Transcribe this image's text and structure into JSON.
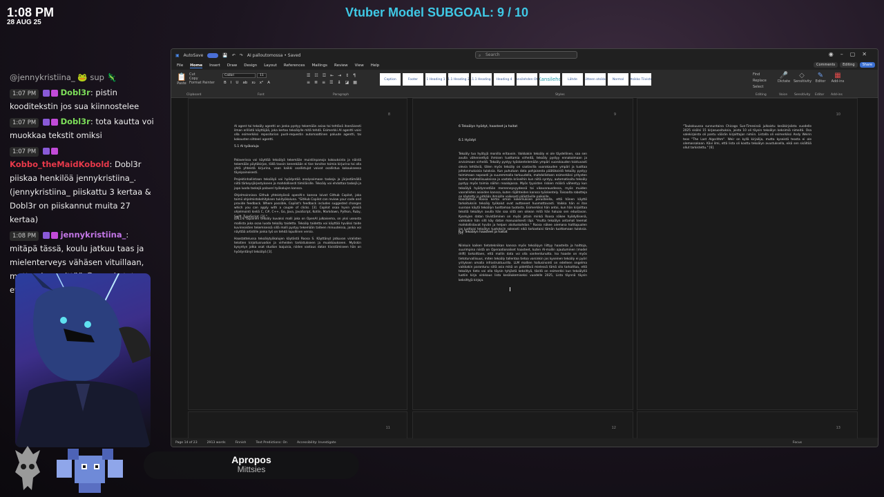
{
  "overlay": {
    "time": "1:08 PM",
    "date": "28 AUG 25",
    "subgoal": "Vtuber Model SUBGOAL: 9 / 10",
    "now_playing": {
      "song": "Apropos",
      "artist": "Mittsies"
    }
  },
  "chat": {
    "partial": "@jennykristiina_ 🐸 sup 🦎",
    "messages": [
      {
        "time": "1:07 PM",
        "user": "Dobl3r",
        "user_color": "#7ddf5a",
        "text": ": pistin kooditekstin jos sua kiinnostelee"
      },
      {
        "time": "1:07 PM",
        "user": "Dobl3r",
        "user_color": "#7ddf5a",
        "text": ": tota kautta voi muokkaa tekstit omiksi"
      },
      {
        "time": "1:07 PM",
        "user": "Kobbo_theMaidKobold",
        "user_color": "#e8394a",
        "text": ": Dobl3r piiskaa henkilöä jennykristiina_. (jennykristiina_ piiskattu 3 kertaa & Dobl3r on piiskannut muita 27 kertaa)"
      },
      {
        "time": "1:08 PM",
        "user": "jennykristiina_",
        "user_color": "#c477e8",
        "text": ": mitäpä tässä, koulu jatkuu taas ja mielenterveys vähäsen vituillaan, mutta ei se mittää 😆 porskutetaan eteenpäin"
      }
    ]
  },
  "word": {
    "autosave": "AutoSave",
    "doc_title": "AI palloutomossa • Saved",
    "search_placeholder": "Search",
    "menu": [
      "File",
      "Home",
      "Insert",
      "Draw",
      "Design",
      "Layout",
      "References",
      "Mailings",
      "Review",
      "View",
      "Help"
    ],
    "active_menu": "Home",
    "comments": "Comments",
    "editing": "Editing",
    "share": "Share",
    "clipboard": {
      "paste": "Paste",
      "cut": "Cut",
      "copy": "Copy",
      "format_painter": "Format Painter",
      "label": "Clipboard"
    },
    "font": {
      "name": "Calibri",
      "size": "11",
      "label": "Font",
      "buttons": [
        "B",
        "I",
        "U",
        "ab",
        "x₂",
        "x²",
        "A"
      ]
    },
    "paragraph_label": "Paragraph",
    "styles_label": "Styles",
    "styles": [
      "Caption",
      "Footer",
      "1 Heading 1",
      "1.1 Heading 2",
      "1.1.1 Heading 3",
      "Heading 4",
      "Kansilehden Otsi",
      "Kansileho",
      "Lähde",
      "Liitteen otsikko",
      "Normal",
      "Otsikko Tiivistel"
    ],
    "right_tools": [
      {
        "name": "Find",
        "label": "Editing"
      },
      {
        "name": "Dictate",
        "label": "Voice"
      },
      {
        "name": "Sensitivity",
        "label": "Sensitivity"
      },
      {
        "name": "Editor",
        "label": "Editor"
      },
      {
        "name": "Add-ins",
        "label": "Add-ins"
      }
    ],
    "replace": "Replace",
    "select": "Select",
    "pages": [
      {
        "num": "8",
        "blocks": [
          {
            "kind": "p",
            "text": "AI agent tai tekoäly agentti on jonka pystyy tekemään asiaa tai tehtävä itsenäisesti ilman erillistä käyttäjää, joka kertoo tekoälylle mitä tehdä. Esimerkki AI agentti voisi olla esimerkiksi repositorion push-requestin automaattinen paluute agentti, tai kokousten sihteeri agentti."
          },
          {
            "kind": "h",
            "text": "5.1      AI työkaluja"
          },
          {
            "kind": "p",
            "text": "Palaverissa voi käyttää tekoälyä tekemään muistiinpanoja kokouksista ja näistä tekemään pöytäkirjan, tällä tavoin kenenkään ei tise tarvitse toimia kirjurina tai olla yhtä yhteistä kirjurina, vaan kaikki osallistujat voivat osallistua kokoukseesa täysipainoisesti."
          },
          {
            "kind": "p",
            "text": "Projektinhallintaan tekoälyä voi hyödyntää analysoimaan taskeja ja järjestämällä niitä tärkeysjärjestykseen ja mahdollisesti tiimiläisille. Tekoäly voi ehdottaa taskejä ja jopa luoda taskejä palaveri työkalujen kanssa."
          },
          {
            "kind": "p",
            "text": "Ohjelmoinnissa Github yhteistyössä openAI:n kanssa loivat Github Copilot, joka toimii ohjelmistokehityksen tukityökaluna. \"GitHub Copilot can review your code and provide feedback. Where possible, Copilot's feedback includes suggested changes which you can apply with a couple of clicks. [3]. Copilot osaa hyvin yleisiä ohjelmointi kieliä C, C#, C++, Go, Java, JavaScript, Kotlin, Markdown, Python, Ruby, Swift, TypeScript. [3].\""
          },
          {
            "kind": "p",
            "text": "DALL-E tapainen tekoäly kuvaksi malli joka on OpenAI julkaisema, on yksi useasta mallista joka osaa luoda tekoäly taidetta. Tekoäly taidetta voi käyttää hyväksi taide kuvinnoisten tekemisessä sillä malli pystyy tekemään taiteen minuuteissa, jonka voi näyttää artistille jonka työ on tehdä lopullinen versio."
          },
          {
            "kind": "p",
            "text": "Haastattelussa tekoälytyökalujen käytöstä Roosa S. Käyttänyt jatkuvan viralisten tekstien kirjoitusruodon ja virheiden tarkistukseen ja muokkaukseen. Myöskin kysyntyn jotka osat studion laajuisia, niiden vastaus datan tiivistämiseen hän on hyödyntänyt tekoälyä [3]."
          }
        ]
      },
      {
        "num": "9",
        "blocks": [
          {
            "kind": "h",
            "text": "6        Tekoälyn hyödyt, haasteet ja haitat"
          },
          {
            "kind": "h",
            "text": "6.1      Hyödyt"
          },
          {
            "kind": "p",
            "text": "Tekoäly tuo hyötyjä monilla eritavoin. Vaikkakin tekoäly ei ole täydellinen, saa sen avulla vähennettyä ihmisen tuottamia virheitä, tekoäly pystyy ennakoimaan ja arvioimaan virheitä. Tekoäly pystyy työskentelemään ympäri vuorokauden toistuvasti olevia tehtäviä, täten myös tekoäly on saatavilla vuorokauden ympäri ja tuottaa johdonmukaisia tuloksia. Kun puhutaan data pohjaisesta päätöksistä tekoäly pystyy toimimaan nopeasti ja suuremmalla tarkuudella, mahdollistaen esimerkiksi yritysten toimia mahdollisuuksissa ja vastata kriiseihin kun niitä syntyy, automatisoitu tekoäly pystyy myös toimia näihin reaalajassa. Myös fyysisten riskien määrä vähentyy kun tekoälyä hyödynnetään merenneyvyydessä tai vikavarausdessa, myös muiden vaarallisten asioiden kanssa, kuten räjähteiden kanssa työskentely. Toisaalta robotteja on käytetty jo pitkään ihmisille vaikeasti päästäville paikoille."
          },
          {
            "kind": "p",
            "text": "Haastattelu Roosa kertoi oman kokemuksen perusteella, että hänen käyttö tarkoituksiin tekoäly työkalut ovat auttaneet huomattavasti. Vaikka hän ei itse suoraan käytä tekoälyn tuottamaa tuotosta. Esimerkiksi hän antoi, kun hän kirjoittaa tekstiä tekoälyn avulla hän saa siitä sen oikean mitä hän haluaa sen edustavan. Kyselyjen datan tiivistäminen on myös jotain minkä Roosa näkee hyödyllisenä, vaikkakin hän silti käy datan manuaalisesti läpi. \"mutta tekoälyn antamat teemat mahdollistavat hyvän ja helpon aloituskohdan.\" Roosa näkee aiemana haittapuolen jos luottaisi tekoälyn tuotoksiin sokeasti eikä tarkastaisi tämän tuottamaan tuloksia. [3]."
          },
          {
            "kind": "h",
            "text": "6.2      Tekoälyn haasteet ja haitat"
          },
          {
            "kind": "p",
            "text": "Niinkuin kaiken tietotekniikan kanssa myös tekoälyyn liittyy haasteita ja haittoja, suurimpina niistä on Operaationaliset haasteet, kuten AI-mallin ajautuminen (model drift) tarkoittaen, että mallin data voi olla vanhentunutta. Iso haaste on myös tietoturvallisuus, miten tekoäly tallentaa tietoa varsinkin jos kyseinen tekoäly ei pyöri yrityksen omalla infrastruktuurilla. LLM mallien hallusinointi on edelleen ongelma vaikkakin parantunu siitä asia mikä on pidettävä mielessä tämä silo tarkoittaa, että tekoälyn tieto voi olla täysin tyhjästä keksittyä, täsitä on esimerkki kun tekoälyllä luotiin kirja vinkkaus lista kesälukemiseksi vuodelle 2025, Lista täynnä täysin keksittyjä kirjoja."
          }
        ]
      },
      {
        "num": "10",
        "blocks": [
          {
            "kind": "p",
            "text": "\"Toukokuussa sunnuntaina Chicago Sun-Timesissä julkaistu kesäkirjalista vuodelle 2025 sisälsi 15 kirjasuosituksia, joista 10 oli täysin tekoälyn keksimiä nimeitä. Osa valekirjoista oli pantu väärän kirjoittajan nimiin. Listalla oli esimerkiksi Andy Weirin teos \"The Last Algorithm\". Weir on kyllä kirjailija, mutta kyseistä teosta ei ole olemassakaan. Kävi ilmi, että lista oli koottu tekoälyn avustuksella, eikä sen sisältöä ollut tarkistettu.\" [6]."
          }
        ]
      },
      {
        "num": "11",
        "blocks": []
      },
      {
        "num": "12",
        "blocks": []
      },
      {
        "num": "13",
        "blocks": []
      }
    ],
    "status": {
      "page": "Page 14 of 23",
      "words": "2913 words",
      "language": "Finnish",
      "text_predictions": "Text Predictions: On",
      "accessibility": "Accessibility: Investigate",
      "focus": "Focus"
    }
  }
}
